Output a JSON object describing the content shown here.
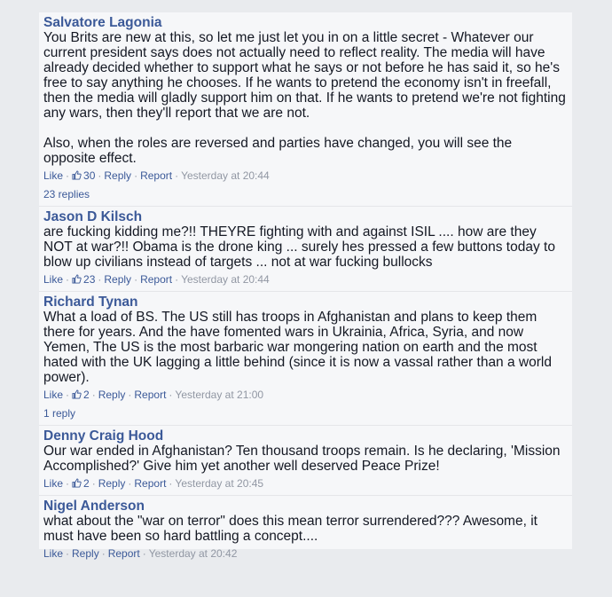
{
  "comments": [
    {
      "author": "Salvatore Lagonia",
      "text": "You Brits are new at this, so let me just let you in on a little secret - Whatever our current president says does not actually need to reflect reality. The media will have already decided whether to support what he says or not before he has said it, so he's free to say anything he chooses. If he wants to pretend the economy isn't in freefall, then the media will gladly support him on that. If he wants to pretend we're not fighting any wars, then they'll report that we are not.\n\nAlso, when the roles are reversed and parties have changed, you will see the opposite effect.",
      "like_label": "Like",
      "likes": "30",
      "reply_label": "Reply",
      "report_label": "Report",
      "time": "Yesterday at 20:44",
      "replies": "23 replies"
    },
    {
      "author": "Jason D Kilsch",
      "text": "are fucking kidding me?!! THEYRE fighting with and against ISIL .... how are they NOT at war?!! Obama is the drone king ... surely hes pressed a few buttons today to blow up civilians instead of targets ... not at war fucking bullocks",
      "like_label": "Like",
      "likes": "23",
      "reply_label": "Reply",
      "report_label": "Report",
      "time": "Yesterday at 20:44"
    },
    {
      "author": "Richard Tynan",
      "text": "What a load of BS. The US still has troops in Afghanistan and plans to keep them there for years. And the have fomented wars in Ukrainia, Africa, Syria, and now Yemen, The US is the most barbaric war mongering nation on earth and the most hated with the UK lagging a little behind (since it is now a vassal rather than a world power).",
      "like_label": "Like",
      "likes": "2",
      "reply_label": "Reply",
      "report_label": "Report",
      "time": "Yesterday at 21:00",
      "replies": "1 reply"
    },
    {
      "author": "Denny Craig Hood",
      "text": "Our war ended in Afghanistan? Ten thousand troops remain. Is he declaring, 'Mission Accomplished?' Give him yet another well deserved Peace Prize!",
      "like_label": "Like",
      "likes": "2",
      "reply_label": "Reply",
      "report_label": "Report",
      "time": "Yesterday at 20:45"
    },
    {
      "author": "Nigel Anderson",
      "text": "what about the \"war on terror\" does this mean terror surrendered??? Awesome, it must have been so hard battling a concept....",
      "like_label": "Like",
      "reply_label": "Reply",
      "report_label": "Report",
      "time": "Yesterday at 20:42"
    }
  ]
}
